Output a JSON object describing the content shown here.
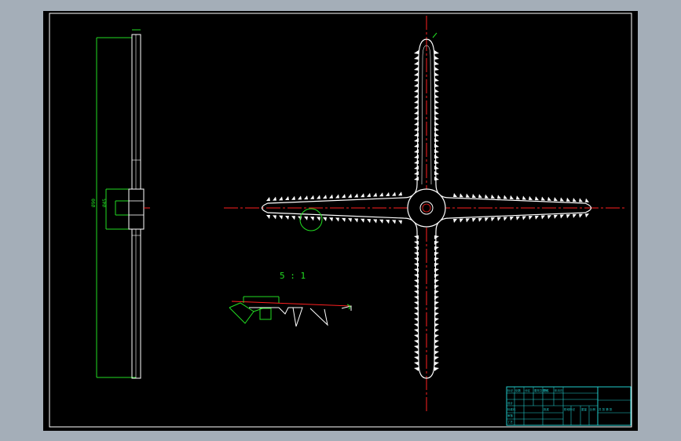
{
  "viewport": {
    "background": "#000000",
    "frame_color": "#ffffff",
    "line_color": "#ffffff",
    "centerline_color": "#ff2020",
    "dimension_color": "#22dd22",
    "titleblock_color": "#22cccc"
  },
  "detail": {
    "scale_label": "5 : 1"
  },
  "side_view": {
    "dimension_labels": [
      "Ø90",
      "Ø45"
    ]
  },
  "title_block": {
    "cells": [
      "标记",
      "处数",
      "分区",
      "更改文件号",
      "签名",
      "年月日",
      "设计",
      "标准化",
      "审核",
      "工艺",
      "批准",
      "阶段标记",
      "重量",
      "比例",
      "共 张 第 张"
    ]
  }
}
